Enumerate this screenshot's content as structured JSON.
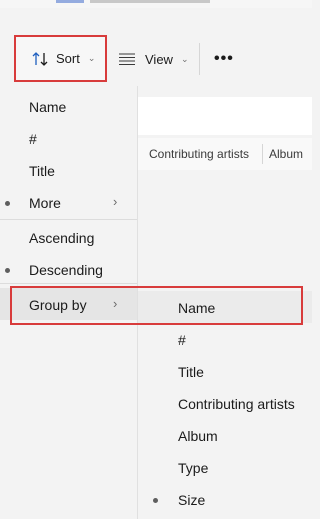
{
  "toolbar": {
    "sort_label": "Sort",
    "view_label": "View",
    "more_label": "•••"
  },
  "columns": {
    "contributing_artists": "Contributing artists",
    "album": "Album"
  },
  "sort_menu": {
    "name": "Name",
    "hash": "#",
    "title": "Title",
    "more": "More",
    "ascending": "Ascending",
    "descending": "Descending",
    "group_by": "Group by",
    "selected_order": "Descending"
  },
  "group_by_menu": {
    "items": [
      "Name",
      "#",
      "Title",
      "Contributing artists",
      "Album",
      "Type",
      "Size"
    ],
    "selected": "Size"
  },
  "colors": {
    "highlight": "#d83b3b",
    "menu_bg": "#f3f3f3"
  }
}
